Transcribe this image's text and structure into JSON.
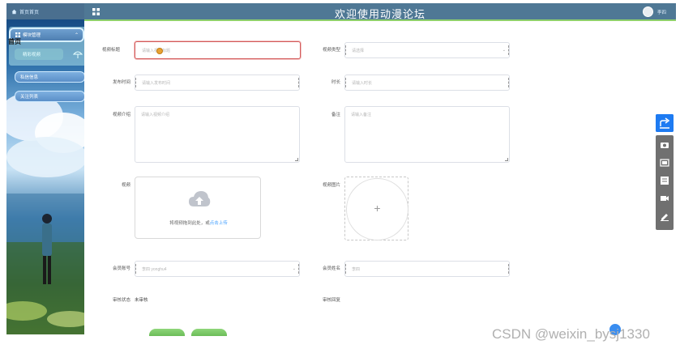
{
  "app": {
    "title": "欢迎使用动漫论坛",
    "user": "李四"
  },
  "sidebar": {
    "home_label": "首页首页",
    "stray_label": "首页",
    "active_menu": "模块管理",
    "sub_item": "精彩视频",
    "items": [
      {
        "label": "私信信息"
      },
      {
        "label": "关注列表"
      }
    ]
  },
  "form": {
    "video_title": {
      "label": "视频标题",
      "placeholder": "请输入视频标题"
    },
    "video_type": {
      "label": "视频类型",
      "placeholder": "请选择"
    },
    "publish_time": {
      "label": "发布时间",
      "placeholder": "请输入发布时间"
    },
    "duration": {
      "label": "时长",
      "placeholder": "请输入时长"
    },
    "intro": {
      "label": "视频介绍",
      "placeholder": "请输入视频介绍"
    },
    "remark": {
      "label": "备注",
      "placeholder": "请输入备注"
    },
    "video": {
      "label": "视频",
      "hint": "将视频拖到此处，或",
      "link": "点击上传"
    },
    "video_image": {
      "label": "视频图片"
    },
    "member_no": {
      "label": "会员账号",
      "value": "李四 yonghu4"
    },
    "member_name": {
      "label": "会员姓名",
      "value": "李四"
    },
    "audit_status": {
      "label": "审核状态",
      "value": "未审核"
    },
    "audit_reply": {
      "label": "审核回复"
    }
  },
  "watermark": "CSDN @weixin_bysj1330",
  "colors": {
    "topbar": "#4f7895",
    "accent_line": "#8fd06b",
    "share": "#1e7bf2",
    "tool_panel": "#707070"
  },
  "icons": [
    "home-icon",
    "grid-icon",
    "chevron-up-icon",
    "umbrella-icon",
    "cloud-upload-icon",
    "plus-icon",
    "share-icon",
    "camera-icon",
    "screenshot-icon",
    "ocr-icon",
    "record-icon",
    "edit-icon"
  ]
}
